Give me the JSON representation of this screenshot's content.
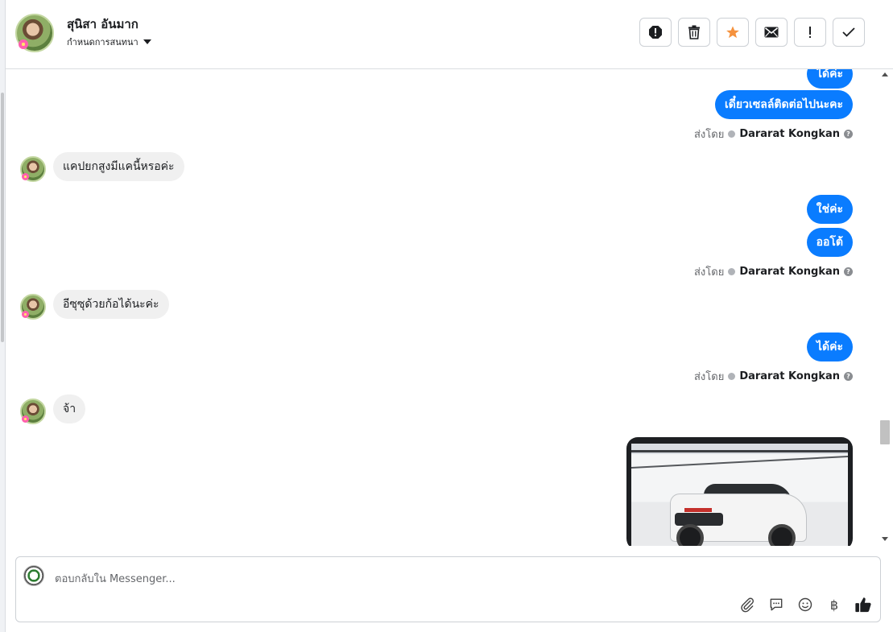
{
  "header": {
    "contact_name": "สุนิสา อันมาก",
    "assign_label": "กำหนดการสนทนา"
  },
  "actions": [
    {
      "name": "report-spam-button",
      "icon": "octagon-alert-icon"
    },
    {
      "name": "delete-button",
      "icon": "trash-icon"
    },
    {
      "name": "star-button",
      "icon": "star-icon"
    },
    {
      "name": "mark-unread-button",
      "icon": "envelope-icon"
    },
    {
      "name": "mark-important-button",
      "icon": "exclamation-icon"
    },
    {
      "name": "mark-done-button",
      "icon": "checkmark-icon"
    }
  ],
  "colors": {
    "outgoing_bubble": "#0a7cff",
    "incoming_bubble": "#f0f0f0",
    "star": "#f5923e"
  },
  "thread": {
    "sent_by_label": "ส่งโดย",
    "agent_name": "Dararat Kongkan",
    "messages": [
      {
        "dir": "out",
        "text": "ได้ค่ะ"
      },
      {
        "dir": "out",
        "text": "เดี๋ยวเซลล์ติดต่อไปนะคะ"
      },
      {
        "dir": "in",
        "text": "แคปยกสูงมีแคนี้หรอค่ะ"
      },
      {
        "dir": "out",
        "text": "ใช่ค่ะ"
      },
      {
        "dir": "out",
        "text": "ออโต้"
      },
      {
        "dir": "in",
        "text": "อีซุซุด้วยก้อได้นะค่ะ"
      },
      {
        "dir": "out",
        "text": "ได้ค่ะ"
      },
      {
        "dir": "in",
        "text": "จ้า"
      }
    ]
  },
  "composer": {
    "placeholder": "ตอบกลับใน Messenger..."
  }
}
